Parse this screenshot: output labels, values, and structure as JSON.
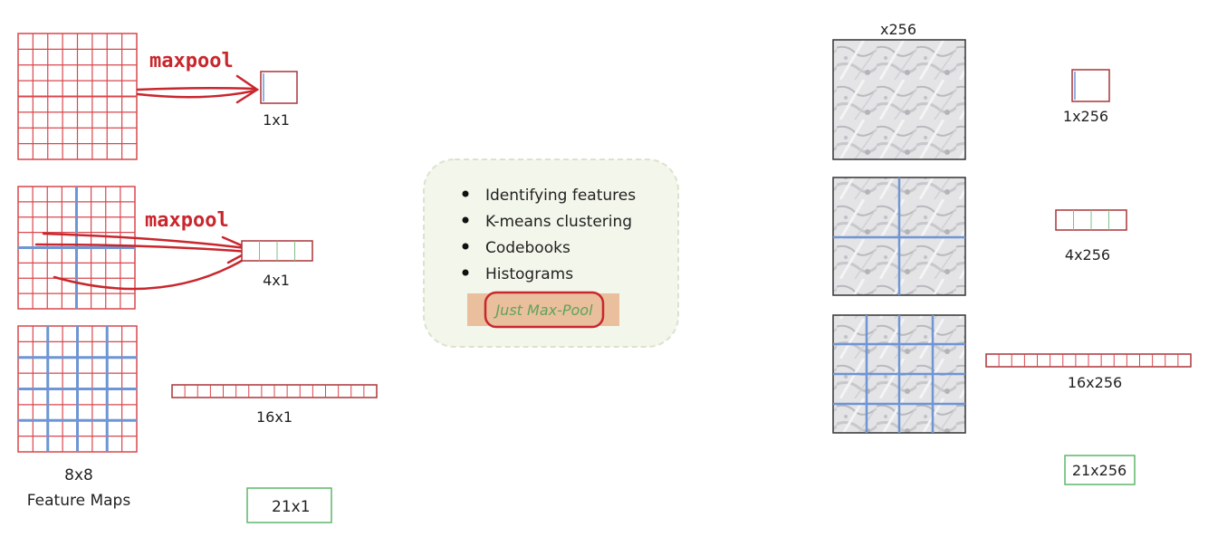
{
  "left": {
    "maxpool_label_1": "maxpool",
    "maxpool_label_2": "maxpool",
    "out_1x1": "1x1",
    "out_4x1": "4x1",
    "out_16x1": "16x1",
    "out_21x1": "21x1",
    "grid_caption_line1": "8x8",
    "grid_caption_line2": "Feature Maps"
  },
  "center": {
    "bullets": [
      "Identifying features",
      "K-means clustering",
      "Codebooks",
      "Histograms"
    ],
    "highlight": "Just Max-Pool"
  },
  "right": {
    "top_label": "x256",
    "out_1x256": "1x256",
    "out_4x256": "4x256",
    "out_16x256": "16x256",
    "out_21x256": "21x256"
  },
  "colors": {
    "grid_red": "#d9474d",
    "divider_blue": "#6f95d4",
    "box_green": "#5fb56a",
    "box_dark_red": "#a8353a",
    "panel_bg": "#f3f6ea",
    "highlight_bg": "#e9bf9e",
    "highlight_text": "#5fa35c"
  }
}
